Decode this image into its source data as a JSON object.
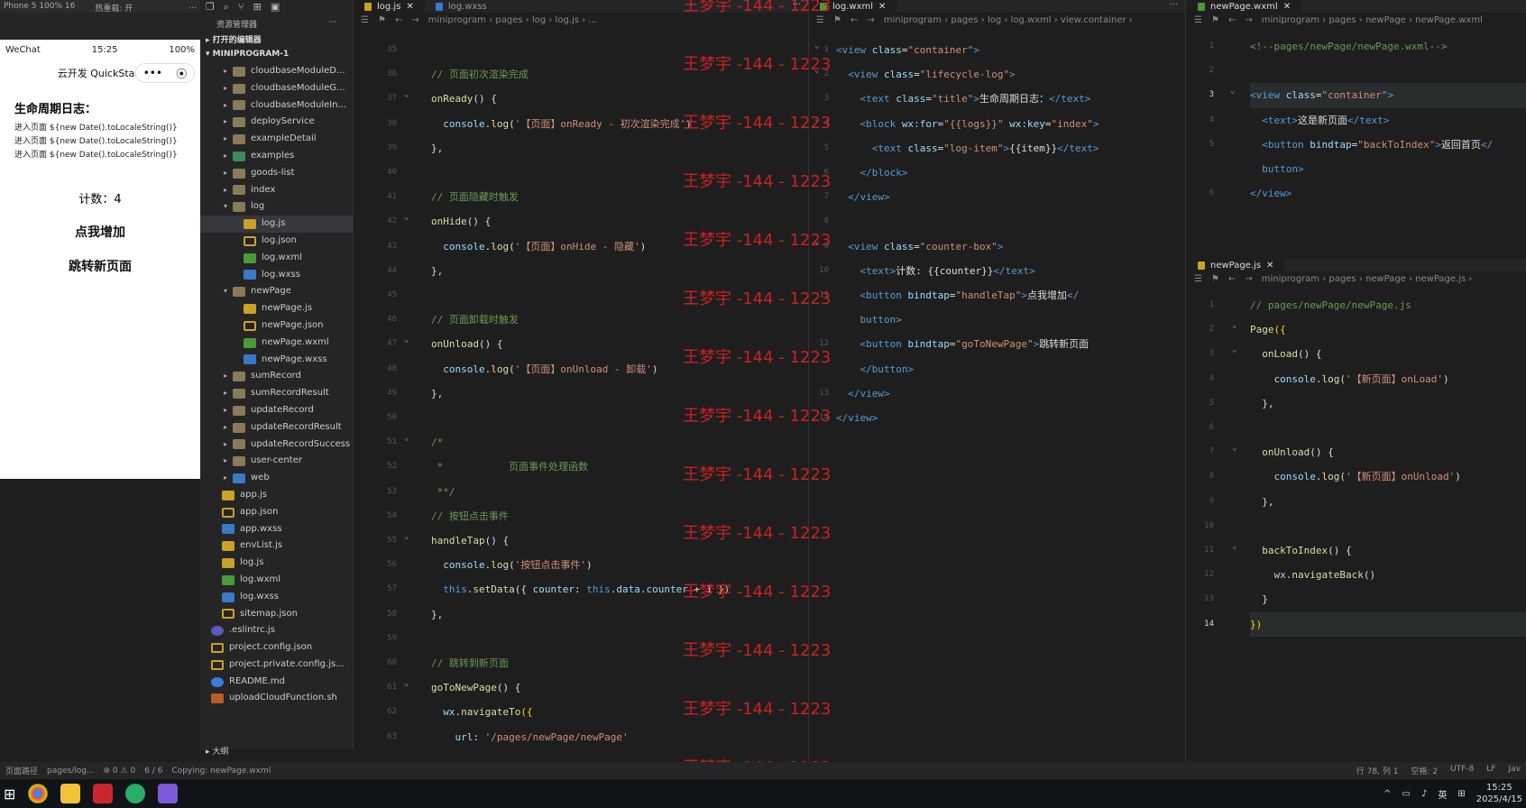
{
  "simulator": {
    "device": "Phone 5 100% 16",
    "hot_reload": "热重载: 开",
    "more": "...",
    "status_carrier": "WeChat",
    "status_time": "15:25",
    "status_battery": "100%",
    "nav_title": "云开发 QuickStart",
    "capsule_more": "•••",
    "capsule_close": "⦿",
    "page_title": "生命周期日志：",
    "logs": [
      "进入页面 ${new Date().toLocaleString()}",
      "进入页面 ${new Date().toLocaleString()}",
      "进入页面 ${new Date().toLocaleString()}"
    ],
    "counter_text": "计数：4",
    "btn_add": "点我增加",
    "btn_nav": "跳转新页面"
  },
  "explorer": {
    "title": "资源管理器",
    "more": "···",
    "open_editors": "打开的编辑器",
    "project": "MINIPROGRAM-1",
    "outline": "大纲",
    "tree": [
      {
        "label": "cloudbaseModuleD...",
        "type": "folder",
        "depth": 1,
        "arrow": "▸"
      },
      {
        "label": "cloudbaseModuleG...",
        "type": "folder",
        "depth": 1,
        "arrow": "▸"
      },
      {
        "label": "cloudbaseModuleIn...",
        "type": "folder",
        "depth": 1,
        "arrow": "▸"
      },
      {
        "label": "deployService",
        "type": "folder",
        "depth": 1,
        "arrow": "▸"
      },
      {
        "label": "exampleDetail",
        "type": "folder",
        "depth": 1,
        "arrow": "▸"
      },
      {
        "label": "examples",
        "type": "folder-g",
        "depth": 1,
        "arrow": "▸"
      },
      {
        "label": "goods-list",
        "type": "folder",
        "depth": 1,
        "arrow": "▸"
      },
      {
        "label": "index",
        "type": "folder",
        "depth": 1,
        "arrow": "▸"
      },
      {
        "label": "log",
        "type": "folder",
        "depth": 1,
        "arrow": "▾"
      },
      {
        "label": "log.js",
        "type": "js",
        "depth": 2,
        "arrow": "",
        "sel": true
      },
      {
        "label": "log.json",
        "type": "json",
        "depth": 2,
        "arrow": ""
      },
      {
        "label": "log.wxml",
        "type": "wxml",
        "depth": 2,
        "arrow": ""
      },
      {
        "label": "log.wxss",
        "type": "wxss",
        "depth": 2,
        "arrow": ""
      },
      {
        "label": "newPage",
        "type": "folder",
        "depth": 1,
        "arrow": "▾"
      },
      {
        "label": "newPage.js",
        "type": "js",
        "depth": 2,
        "arrow": ""
      },
      {
        "label": "newPage.json",
        "type": "json",
        "depth": 2,
        "arrow": ""
      },
      {
        "label": "newPage.wxml",
        "type": "wxml",
        "depth": 2,
        "arrow": ""
      },
      {
        "label": "newPage.wxss",
        "type": "wxss",
        "depth": 2,
        "arrow": ""
      },
      {
        "label": "sumRecord",
        "type": "folder",
        "depth": 1,
        "arrow": "▸"
      },
      {
        "label": "sumRecordResult",
        "type": "folder",
        "depth": 1,
        "arrow": "▸"
      },
      {
        "label": "updateRecord",
        "type": "folder",
        "depth": 1,
        "arrow": "▸"
      },
      {
        "label": "updateRecordResult",
        "type": "folder",
        "depth": 1,
        "arrow": "▸"
      },
      {
        "label": "updateRecordSuccess",
        "type": "folder",
        "depth": 1,
        "arrow": "▸"
      },
      {
        "label": "user-center",
        "type": "folder",
        "depth": 1,
        "arrow": "▸"
      },
      {
        "label": "web",
        "type": "folder-b",
        "depth": 1,
        "arrow": "▸"
      },
      {
        "label": "app.js",
        "type": "js",
        "depth": 0,
        "arrow": ""
      },
      {
        "label": "app.json",
        "type": "json",
        "depth": 0,
        "arrow": ""
      },
      {
        "label": "app.wxss",
        "type": "wxss",
        "depth": 0,
        "arrow": ""
      },
      {
        "label": "envList.js",
        "type": "js",
        "depth": 0,
        "arrow": ""
      },
      {
        "label": "log.js",
        "type": "js",
        "depth": 0,
        "arrow": ""
      },
      {
        "label": "log.wxml",
        "type": "wxml",
        "depth": 0,
        "arrow": ""
      },
      {
        "label": "log.wxss",
        "type": "wxss",
        "depth": 0,
        "arrow": ""
      },
      {
        "label": "sitemap.json",
        "type": "json",
        "depth": 0,
        "arrow": ""
      },
      {
        "label": ".eslintrc.js",
        "type": "eslint",
        "depth": -1,
        "arrow": ""
      },
      {
        "label": "project.config.json",
        "type": "json",
        "depth": -1,
        "arrow": ""
      },
      {
        "label": "project.private.config.js...",
        "type": "json",
        "depth": -1,
        "arrow": ""
      },
      {
        "label": "README.md",
        "type": "md",
        "depth": -1,
        "arrow": ""
      },
      {
        "label": "uploadCloudFunction.sh",
        "type": "sh",
        "depth": -1,
        "arrow": ""
      }
    ]
  },
  "editor1": {
    "tabs": [
      {
        "label": "log.js",
        "active": true,
        "close": "✕"
      },
      {
        "label": "log.wxss",
        "active": false,
        "close": ""
      }
    ],
    "more": "···",
    "breadcrumb": "miniprogram  ›  pages  ›  log  ›  log.js  ›  ...",
    "lines": [
      {
        "n": "35",
        "html": ""
      },
      {
        "n": "36",
        "html": "<span class='c'>// 页面初次渲染完成</span>"
      },
      {
        "n": "37",
        "html": "<span class='f'>onReady</span><span class='p'>() {</span>"
      },
      {
        "n": "38",
        "html": "  <span class='a'>console</span><span class='p'>.</span><span class='f'>log</span><span class='p'>(</span><span class='s'>'【页面】onReady - 初次渲染完成'</span><span class='p'>)</span>"
      },
      {
        "n": "39",
        "html": "<span class='p'>},</span>"
      },
      {
        "n": "40",
        "html": ""
      },
      {
        "n": "41",
        "html": "<span class='c'>// 页面隐藏时触发</span>"
      },
      {
        "n": "42",
        "html": "<span class='f'>onHide</span><span class='p'>() {</span>"
      },
      {
        "n": "43",
        "html": "  <span class='a'>console</span><span class='p'>.</span><span class='f'>log</span><span class='p'>(</span><span class='s'>'【页面】onHide - 隐藏'</span><span class='p'>)</span>"
      },
      {
        "n": "44",
        "html": "<span class='p'>},</span>"
      },
      {
        "n": "45",
        "html": ""
      },
      {
        "n": "46",
        "html": "<span class='c'>// 页面卸载时触发</span>"
      },
      {
        "n": "47",
        "html": "<span class='f'>onUnload</span><span class='p'>() {</span>"
      },
      {
        "n": "48",
        "html": "  <span class='a'>console</span><span class='p'>.</span><span class='f'>log</span><span class='p'>(</span><span class='s'>'【页面】onUnload - 卸载'</span><span class='p'>)</span>"
      },
      {
        "n": "49",
        "html": "<span class='p'>},</span>"
      },
      {
        "n": "50",
        "html": ""
      },
      {
        "n": "51",
        "html": "<span class='c'>/*</span>"
      },
      {
        "n": "52",
        "html": "<span class='c'> *           页面事件处理函数</span>"
      },
      {
        "n": "53",
        "html": "<span class='c'> **/</span>"
      },
      {
        "n": "54",
        "html": "<span class='c'>// 按钮点击事件</span>"
      },
      {
        "n": "55",
        "html": "<span class='f'>handleTap</span><span class='p'>() {</span>"
      },
      {
        "n": "56",
        "html": "  <span class='a'>console</span><span class='p'>.</span><span class='f'>log</span><span class='p'>(</span><span class='s'>'按钮点击事件'</span><span class='p'>)</span>"
      },
      {
        "n": "57",
        "html": "  <span class='kw'>this</span><span class='p'>.</span><span class='f'>setData</span><span class='p'>({ </span><span class='a'>counter</span><span class='p'>: </span><span class='kw'>this</span><span class='p'>.</span><span class='a'>data</span><span class='p'>.</span><span class='a'>counter</span><span class='p'> + 1 })</span>"
      },
      {
        "n": "58",
        "html": "<span class='p'>},</span>"
      },
      {
        "n": "59",
        "html": ""
      },
      {
        "n": "60",
        "html": "<span class='c'>// 跳转到新页面</span>"
      },
      {
        "n": "61",
        "html": "<span class='f'>goToNewPage</span><span class='p'>() {</span>"
      },
      {
        "n": "62",
        "html": "  <span class='a'>wx</span><span class='p'>.</span><span class='f'>navigateTo</span><span class='y'>({</span>"
      },
      {
        "n": "63",
        "html": "    <span class='a'>url</span><span class='p'>: </span><span class='s'>'/pages/newPage/newPage'</span>"
      }
    ]
  },
  "watermark": "王梦宇 -144 - 1223",
  "editor2": {
    "tabs": [
      {
        "label": "log.wxml",
        "active": true,
        "close": "✕"
      }
    ],
    "more": "···",
    "breadcrumb": "miniprogram  ›  pages  ›  log  ›  log.wxml  ›  view.container  ›",
    "lines": [
      {
        "n": "1",
        "html": "<span class='tag'>&lt;view</span> <span class='a'>class</span><span class='p'>=</span><span class='s'>\"container\"</span><span class='tag'>&gt;</span>"
      },
      {
        "n": "2",
        "html": "  <span class='tag'>&lt;view</span> <span class='a'>class</span><span class='p'>=</span><span class='s'>\"lifecycle-log\"</span><span class='tag'>&gt;</span>"
      },
      {
        "n": "3",
        "html": "    <span class='tag'>&lt;text</span> <span class='a'>class</span><span class='p'>=</span><span class='s'>\"title\"</span><span class='tag'>&gt;</span><span class='p'>生命周期日志：</span><span class='tag'>&lt;/text&gt;</span>"
      },
      {
        "n": "4",
        "html": "    <span class='tag'>&lt;block</span> <span class='a'>wx:for</span><span class='p'>=</span><span class='s'>\"{{logs}}\"</span> <span class='a'>wx:key</span><span class='p'>=</span><span class='s'>\"index\"</span><span class='tag'>&gt;</span>"
      },
      {
        "n": "5",
        "html": "      <span class='tag'>&lt;text</span> <span class='a'>class</span><span class='p'>=</span><span class='s'>\"log-item\"</span><span class='tag'>&gt;</span><span class='p'>{{item}}</span><span class='tag'>&lt;/text&gt;</span>"
      },
      {
        "n": "6",
        "html": "    <span class='tag'>&lt;/block&gt;</span>"
      },
      {
        "n": "7",
        "html": "  <span class='tag'>&lt;/view&gt;</span>"
      },
      {
        "n": "8",
        "html": ""
      },
      {
        "n": "9",
        "html": "  <span class='tag'>&lt;view</span> <span class='a'>class</span><span class='p'>=</span><span class='s'>\"counter-box\"</span><span class='tag'>&gt;</span>"
      },
      {
        "n": "10",
        "html": "    <span class='tag'>&lt;text&gt;</span><span class='p'>计数: {{counter}}</span><span class='tag'>&lt;/text&gt;</span>"
      },
      {
        "n": "11",
        "html": "    <span class='tag'>&lt;button</span> <span class='a'>bindtap</span><span class='p'>=</span><span class='s'>\"handleTap\"</span><span class='tag'>&gt;</span><span class='p'>点我增加</span><span class='tag'>&lt;/</span>"
      },
      {
        "n": "",
        "html": "    <span class='tag'>button&gt;</span>"
      },
      {
        "n": "12",
        "html": "    <span class='tag'>&lt;button</span> <span class='a'>bindtap</span><span class='p'>=</span><span class='s'>\"goToNewPage\"</span><span class='tag'>&gt;</span><span class='p'>跳转新页面</span>"
      },
      {
        "n": "",
        "html": "    <span class='tag'>&lt;/button&gt;</span>"
      },
      {
        "n": "13",
        "html": "  <span class='tag'>&lt;/view&gt;</span>"
      },
      {
        "n": "14",
        "html": "<span class='tag'>&lt;/view&gt;</span>"
      }
    ]
  },
  "editor3": {
    "tabs": [
      {
        "label": "newPage.wxml",
        "active": true,
        "close": "✕"
      }
    ],
    "breadcrumb": "miniprogram  ›  pages  ›  newPage  ›  newPage.wxml",
    "lines": [
      {
        "n": "1",
        "html": "<span class='c'>&lt;!--pages/newPage/newPage.wxml--&gt;</span>"
      },
      {
        "n": "2",
        "html": ""
      },
      {
        "n": "3",
        "html": "<span class='tag'>&lt;view</span> <span class='a'>class</span><span class='p'>=</span><span class='s'>\"container\"</span><span class='tag'>&gt;</span>"
      },
      {
        "n": "4",
        "html": "  <span class='tag'>&lt;text&gt;</span><span class='p'>这是新页面</span><span class='tag'>&lt;/text&gt;</span>"
      },
      {
        "n": "5",
        "html": "  <span class='tag'>&lt;button</span> <span class='a'>bindtap</span><span class='p'>=</span><span class='s'>\"backToIndex\"</span><span class='tag'>&gt;</span><span class='p'>返回首页</span><span class='tag'>&lt;/</span>"
      },
      {
        "n": "",
        "html": "  <span class='tag'>button&gt;</span>"
      },
      {
        "n": "6",
        "html": "<span class='tag'>&lt;/view&gt;</span>"
      }
    ]
  },
  "editor4": {
    "tabs": [
      {
        "label": "newPage.js",
        "active": true,
        "close": "✕"
      }
    ],
    "breadcrumb": "miniprogram  ›  pages  ›  newPage  ›  newPage.js  ›",
    "lines": [
      {
        "n": "1",
        "html": "<span class='c'>// pages/newPage/newPage.js</span>"
      },
      {
        "n": "2",
        "html": "<span class='f'>Page</span><span class='y'>({</span>"
      },
      {
        "n": "3",
        "html": "  <span class='f'>onLoad</span><span class='p'>() {</span>"
      },
      {
        "n": "4",
        "html": "    <span class='a'>console</span><span class='p'>.</span><span class='f'>log</span><span class='p'>(</span><span class='s'>'【新页面】onLoad'</span><span class='p'>)</span>"
      },
      {
        "n": "5",
        "html": "  <span class='p'>},</span>"
      },
      {
        "n": "6",
        "html": ""
      },
      {
        "n": "7",
        "html": "  <span class='f'>onUnload</span><span class='p'>() {</span>"
      },
      {
        "n": "8",
        "html": "    <span class='a'>console</span><span class='p'>.</span><span class='f'>log</span><span class='p'>(</span><span class='s'>'【新页面】onUnload'</span><span class='p'>)</span>"
      },
      {
        "n": "9",
        "html": "  <span class='p'>},</span>"
      },
      {
        "n": "10",
        "html": ""
      },
      {
        "n": "11",
        "html": "  <span class='f'>backToIndex</span><span class='p'>() {</span>"
      },
      {
        "n": "12",
        "html": "    <span class='a'>wx</span><span class='p'>.</span><span class='f'>navigateBack</span><span class='p'>()</span>"
      },
      {
        "n": "13",
        "html": "  <span class='p'>}</span>"
      },
      {
        "n": "14",
        "html": "<span class='y'>})</span>"
      }
    ]
  },
  "statusbar": {
    "path_label": "页面路径",
    "path": "pages/log...",
    "errors": "⊗ 0 ⚠ 0",
    "count": "6 / 6",
    "copying": "Copying: newPage.wxml",
    "position": "行 78, 列 1",
    "spaces": "空格: 2",
    "encoding": "UTF-8",
    "eol": "LF",
    "lang": "Jav"
  },
  "taskbar": {
    "ime": "英",
    "time": "15:25",
    "date": "2025/4/15"
  },
  "colors": {
    "accent": "#007acc",
    "watermark": "#dd2222",
    "bg": "#1e1e1e"
  }
}
